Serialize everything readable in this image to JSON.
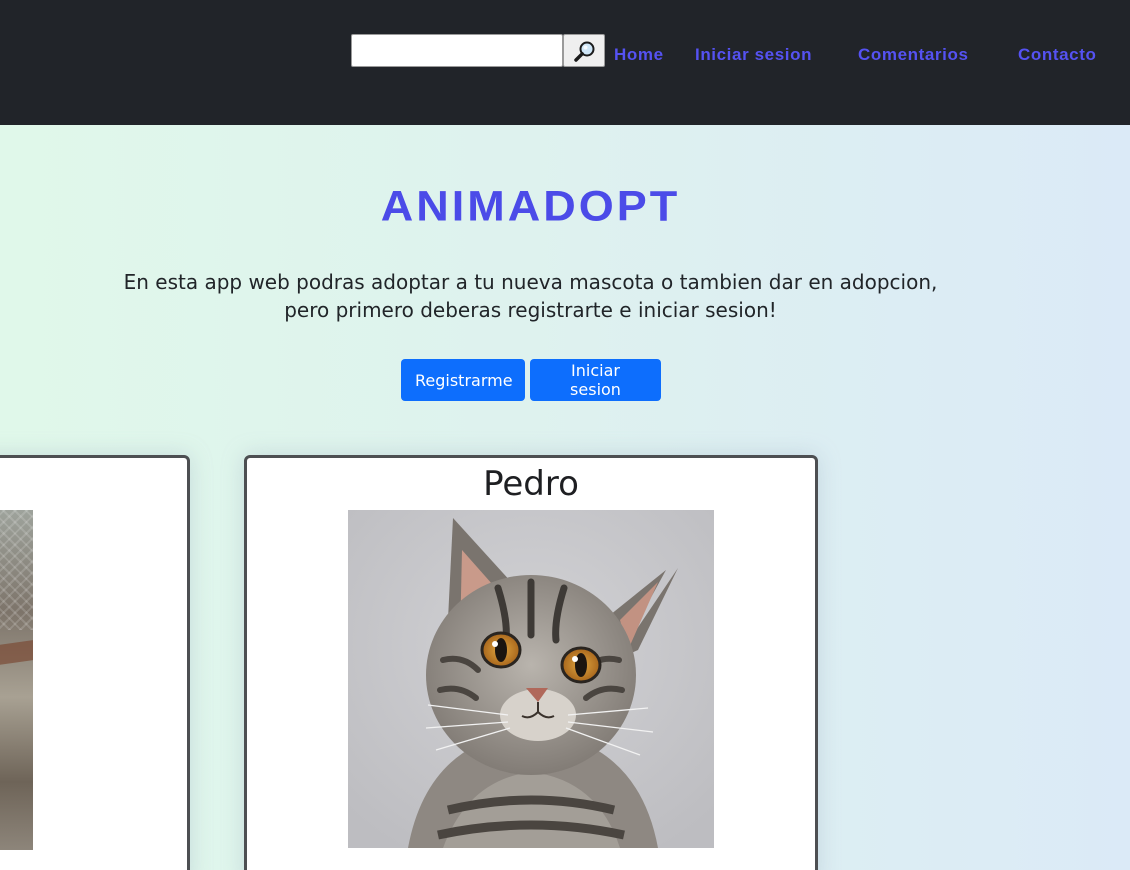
{
  "search": {
    "value": "",
    "placeholder": ""
  },
  "nav": {
    "home": "Home",
    "login": "Iniciar sesion",
    "comments": "Comentarios",
    "contact": "Contacto"
  },
  "hero": {
    "brand": "ANIMADOPT",
    "intro_line1": "En esta app web podras adoptar a tu nueva mascota o tambien dar en adopcion,",
    "intro_line2": "pero primero deberas registrarte e iniciar sesion!",
    "register_label": "Registrarme",
    "login_label": "Iniciar sesion"
  },
  "pets": [
    {
      "name": "Pedro",
      "photo": "tabby-kitten"
    }
  ],
  "colors": {
    "nav_bg": "#212429",
    "link": "#5552f2",
    "brand": "#4b4be8",
    "button": "#0d6efd"
  },
  "icons": {
    "search": "magnifier-icon"
  }
}
